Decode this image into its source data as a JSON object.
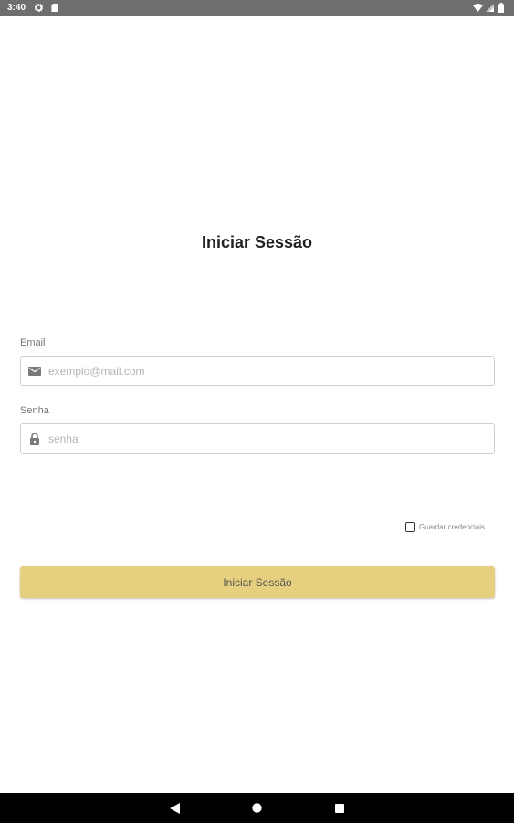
{
  "status_bar": {
    "time": "3:40",
    "icons": [
      "gear-icon",
      "sd-card-icon",
      "wifi-icon",
      "signal-icon",
      "battery-icon"
    ]
  },
  "login": {
    "title": "Iniciar Sessão",
    "email_label": "Email",
    "email_placeholder": "exemplo@mail.com",
    "email_value": "",
    "password_label": "Senha",
    "password_placeholder": "senha",
    "password_value": "",
    "remember_label": "Guardar credenciais",
    "remember_checked": false,
    "submit_label": "Iniciar Sessão"
  },
  "nav_bar": {
    "icons": [
      "back-icon",
      "home-icon",
      "recents-icon"
    ]
  },
  "colors": {
    "status_bar_bg": "#6e6e6e",
    "button_bg": "#e6cf7e",
    "nav_bar_bg": "#000000"
  }
}
